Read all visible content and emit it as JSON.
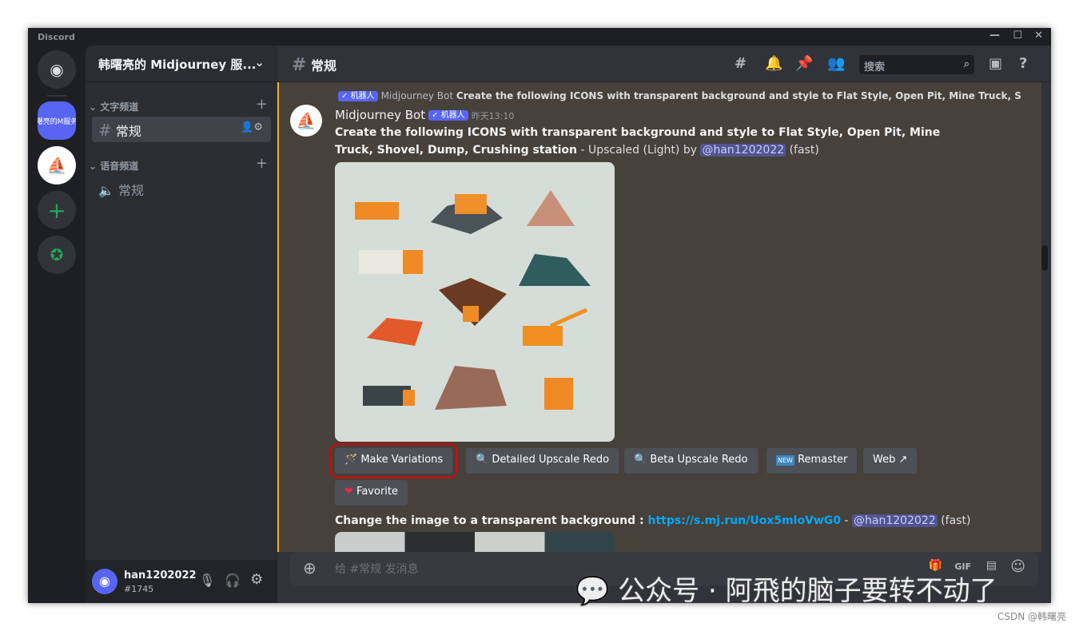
{
  "app": {
    "title": "Discord"
  },
  "server": {
    "name": "韩曙亮的 Midjourney 服...",
    "icon_text": "曙亮的M服务"
  },
  "sidebar": {
    "categories": [
      {
        "label": "文字频道",
        "channels": [
          {
            "label": "常规",
            "type": "text"
          }
        ]
      },
      {
        "label": "语音频道",
        "channels": [
          {
            "label": "常规",
            "type": "voice"
          }
        ]
      }
    ]
  },
  "user": {
    "name": "han1202022",
    "tag": "#1745"
  },
  "header": {
    "channel": "常规",
    "search_placeholder": "搜索"
  },
  "reply": {
    "badge": "✓ 机器人",
    "author": "Midjourney Bot",
    "text": "Create the following ICONS with transparent background and style to Flat Style, Open Pit, Mine Truck, S"
  },
  "message": {
    "author": "Midjourney Bot",
    "badge": "✓ 机器人",
    "time": "昨天13:10",
    "prompt": "Create the following ICONS with transparent background and style to Flat Style, Open Pit, Mine Truck, Shovel, Dump, Crushing station",
    "suffix1": " - Upscaled (Light) by ",
    "mention": "@han1202022",
    "suffix2": " (fast)"
  },
  "buttons": [
    {
      "icon": "magic-wand",
      "label": "Make Variations",
      "highlighted": true
    },
    {
      "icon": "magnifier",
      "label": "Detailed Upscale Redo"
    },
    {
      "icon": "magnifier",
      "label": "Beta Upscale Redo"
    },
    {
      "icon": "new",
      "label": "Remaster"
    },
    {
      "icon": "external-link",
      "label": "Web"
    },
    {
      "icon": "heart",
      "label": "Favorite"
    }
  ],
  "message2": {
    "text": "Change the image to a transparent background : ",
    "link": "https://s.mj.run/Uox5mloVwG0",
    "dash": " - ",
    "mention": "@han1202022",
    "suffix": " (fast)"
  },
  "composer": {
    "placeholder": "给 #常规 发消息"
  },
  "watermark": {
    "text": "公众号 · 阿飛的脑子要转不动了",
    "csdn": "CSDN @韩曙亮"
  },
  "colors": {
    "accent": "#5865f2",
    "highlight_border": "#f0b232",
    "link": "#00a8fc",
    "button_highlight": "#e00000"
  }
}
